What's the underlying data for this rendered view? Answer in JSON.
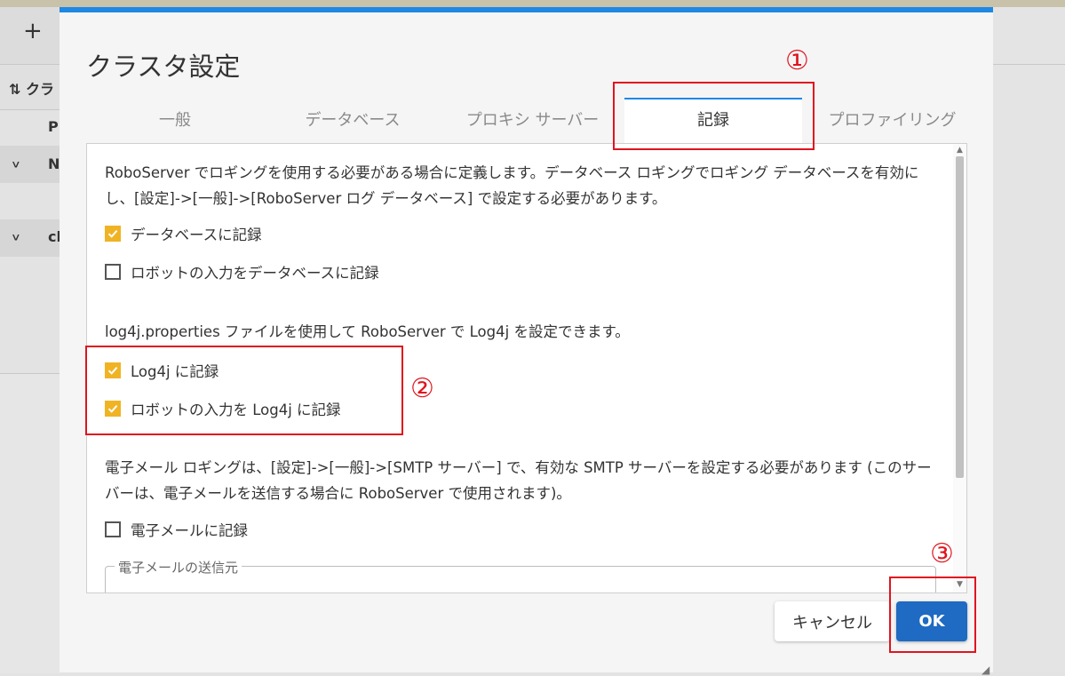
{
  "background": {
    "toolbar_plus": "+",
    "header_text": "⇅ クラ",
    "column_text": "Pr",
    "rows": [
      {
        "chevron": "∨",
        "label": "N"
      },
      {
        "chevron": "∨",
        "label": "cl"
      }
    ]
  },
  "dialog": {
    "title": "クラスタ設定",
    "tabs": [
      {
        "label": "一般",
        "active": false
      },
      {
        "label": "データベース",
        "active": false
      },
      {
        "label": "プロキシ サーバー",
        "active": false
      },
      {
        "label": "記録",
        "active": true
      },
      {
        "label": "プロファイリング",
        "active": false
      }
    ],
    "logging": {
      "db_description": "RoboServer でロギングを使用する必要がある場合に定義します。データベース ロギングでロギング データベースを有効にし、[設定]->[一般]->[RoboServer ログ データベース] で設定する必要があります。",
      "options_db": [
        {
          "label": "データベースに記録",
          "checked": true
        },
        {
          "label": "ロボットの入力をデータベースに記録",
          "checked": false
        }
      ],
      "log4j_description": "log4j.properties ファイルを使用して RoboServer で Log4j を設定できます。",
      "options_log4j": [
        {
          "label": "Log4j に記録",
          "checked": true
        },
        {
          "label": "ロボットの入力を Log4j に記録",
          "checked": true
        }
      ],
      "email_description": "電子メール ロギングは、[設定]->[一般]->[SMTP サーバー] で、有効な SMTP サーバーを設定する必要があります (このサーバーは、電子メールを送信する場合に RoboServer で使用されます)。",
      "options_email": [
        {
          "label": "電子メールに記録",
          "checked": false
        }
      ],
      "email_from_legend": "電子メールの送信元"
    },
    "buttons": {
      "cancel": "キャンセル",
      "ok": "OK"
    }
  },
  "annotations": [
    "①",
    "②",
    "③"
  ],
  "colors": {
    "accent": "#1e88e5",
    "checkbox_checked": "#f0b323",
    "ok_button": "#1f6ac2",
    "annotation": "#e0141e"
  }
}
